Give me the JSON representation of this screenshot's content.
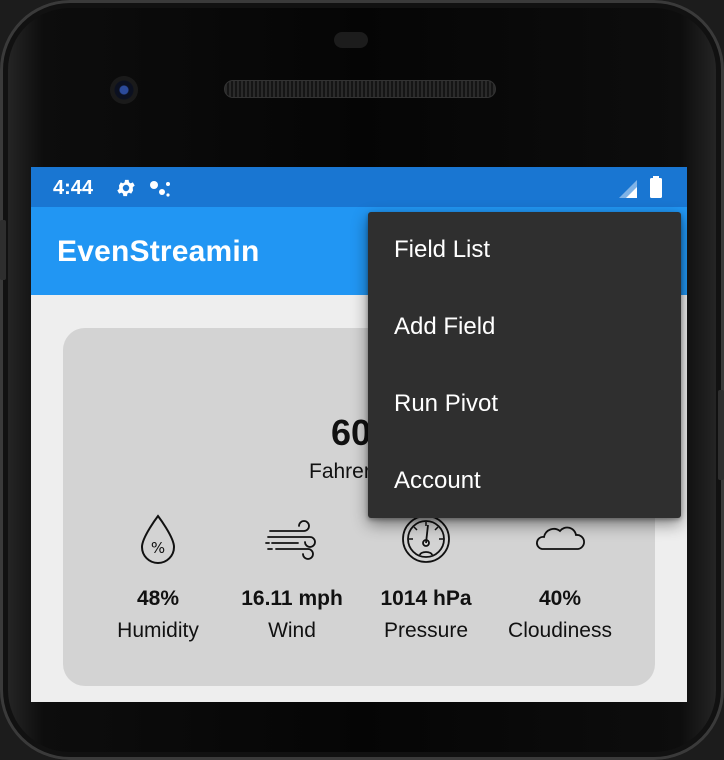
{
  "status_bar": {
    "time": "4:44",
    "icons": [
      "gear-icon",
      "assistant-dots-icon",
      "signal-icon",
      "battery-icon"
    ]
  },
  "app_bar": {
    "title": "EvenStreamin"
  },
  "weather": {
    "temperature": "60",
    "unit_label": "Fahrer",
    "metrics": [
      {
        "icon": "humidity-icon",
        "value": "48%",
        "label": "Humidity"
      },
      {
        "icon": "wind-icon",
        "value": "16.11 mph",
        "label": "Wind"
      },
      {
        "icon": "pressure-gauge-icon",
        "value": "1014 hPa",
        "label": "Pressure"
      },
      {
        "icon": "cloud-icon",
        "value": "40%",
        "label": "Cloudiness"
      }
    ]
  },
  "menu": {
    "items": [
      "Field List",
      "Add Field",
      "Run Pivot",
      "Account"
    ]
  },
  "colors": {
    "status_bar": "#1976d2",
    "app_bar": "#2196f3",
    "card": "#d3d3d3",
    "menu": "#2f2f2f"
  }
}
